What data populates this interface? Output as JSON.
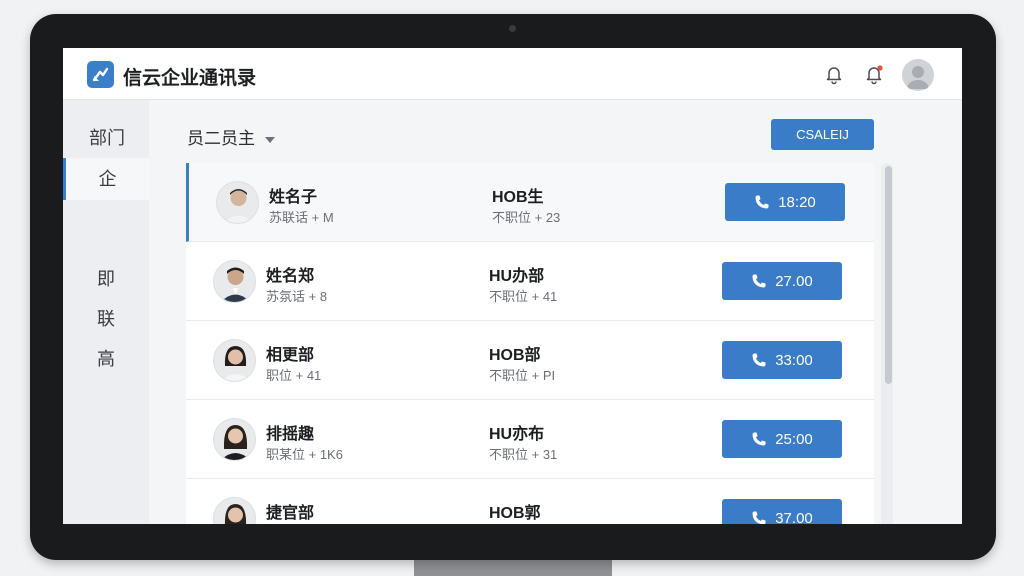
{
  "header": {
    "title": "信云企业通讯录",
    "icons": [
      "logo-icon",
      "bell-outline-icon",
      "bell-notification-icon",
      "user-avatar"
    ],
    "notification_dot_color": "#e5533c"
  },
  "sidebar": {
    "heading": "部门",
    "items": [
      {
        "label": "企",
        "active": true
      },
      {
        "label": "即",
        "active": false
      },
      {
        "label": "联",
        "active": false
      },
      {
        "label": "高",
        "active": false
      }
    ]
  },
  "toolbar": {
    "filter_label": "员二员主",
    "action_label": "CSALEIJ"
  },
  "contacts": [
    {
      "name": "姓名子",
      "sub": "苏联话 + M",
      "dept": "HOB生",
      "dept_sub": "不职位 + 23",
      "call": "18:20",
      "active": true
    },
    {
      "name": "姓名郑",
      "sub": "苏氛话 + 8",
      "dept": "HU办部",
      "dept_sub": "不职位 + 41",
      "call": "27.00",
      "active": false
    },
    {
      "name": "相更部",
      "sub": "职位 + 41",
      "dept": "HOB部",
      "dept_sub": "不职位 + PI",
      "call": "33:00",
      "active": false
    },
    {
      "name": "排摇趣",
      "sub": "职某位 + 1K6",
      "dept": "HU亦布",
      "dept_sub": "不职位 + 31",
      "call": "25:00",
      "active": false
    },
    {
      "name": "捷官部",
      "sub": "",
      "dept": "HOB郭",
      "dept_sub": "",
      "call": "37.00",
      "active": false
    }
  ],
  "colors": {
    "accent": "#3a7cc7",
    "bezel": "#1a1b1d"
  }
}
